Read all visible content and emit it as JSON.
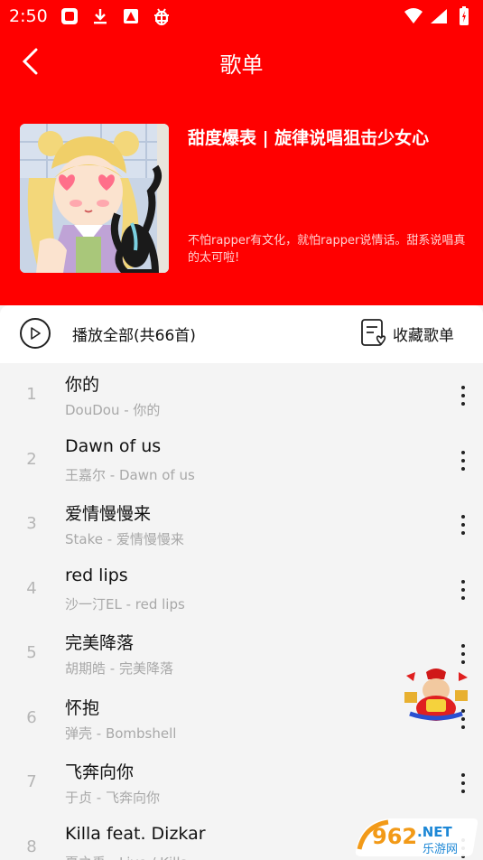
{
  "status_bar": {
    "time": "2:50",
    "left_icons": [
      "app-icon",
      "download-icon",
      "warning-icon",
      "bug-icon"
    ],
    "right_icons": [
      "wifi-icon",
      "signal-icon",
      "battery-icon"
    ]
  },
  "nav": {
    "title": "歌单",
    "back_icon": "chevron-left-icon"
  },
  "playlist": {
    "title": "甜度爆表 | 旋律说唱狙击少女心",
    "description": "不怕rapper有文化，就怕rapper说情话。甜系说唱真的太可啦!"
  },
  "actions": {
    "play_all": "播放全部(共66首)",
    "collect": "收藏歌单"
  },
  "songs": [
    {
      "index": "1",
      "title": "你的",
      "subtitle": "DouDou - 你的"
    },
    {
      "index": "2",
      "title": "Dawn of us",
      "subtitle": "王嘉尔 - Dawn of us"
    },
    {
      "index": "3",
      "title": "爱情慢慢来",
      "subtitle": "Stake - 爱情慢慢来"
    },
    {
      "index": "4",
      "title": "red lips",
      "subtitle": "沙一汀EL - red lips"
    },
    {
      "index": "5",
      "title": "完美降落",
      "subtitle": "胡期皓 - 完美降落"
    },
    {
      "index": "6",
      "title": "怀抱",
      "subtitle": "弹壳 - Bombshell"
    },
    {
      "index": "7",
      "title": "飞奔向你",
      "subtitle": "于贞 - 飞奔向你"
    },
    {
      "index": "8",
      "title": "Killa feat. Dizkar",
      "subtitle": "夏之禹 - Live / Killa"
    }
  ],
  "watermark": {
    "number": "962",
    "suffix": ".NET",
    "name": "乐游网"
  },
  "colors": {
    "header": "#ff0000",
    "list_background": "#f4f4f4"
  }
}
